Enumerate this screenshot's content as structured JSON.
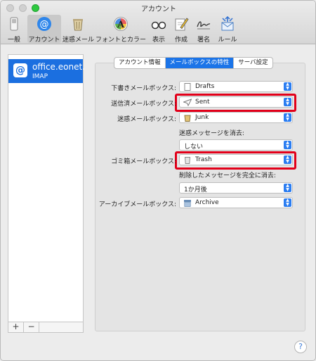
{
  "window": {
    "title": "アカウント"
  },
  "toolbar": {
    "items": [
      {
        "label": "一般",
        "icon": "switch-icon"
      },
      {
        "label": "アカウント",
        "icon": "at-sign-icon",
        "selected": true
      },
      {
        "label": "迷惑メール",
        "icon": "trash-bin-icon"
      },
      {
        "label": "フォントとカラー",
        "icon": "font-color-icon"
      },
      {
        "label": "表示",
        "icon": "glasses-icon"
      },
      {
        "label": "作成",
        "icon": "pencil-paper-icon"
      },
      {
        "label": "署名",
        "icon": "signature-icon"
      },
      {
        "label": "ルール",
        "icon": "rules-envelope-icon"
      }
    ]
  },
  "sidebar": {
    "account": {
      "name": "office.eonet.",
      "type": "IMAP",
      "icon": "at-sign-icon"
    },
    "add_label": "+",
    "remove_label": "−"
  },
  "tabs": [
    {
      "label": "アカウント情報",
      "active": false
    },
    {
      "label": "メールボックスの特性",
      "active": true
    },
    {
      "label": "サーバ設定",
      "active": false
    }
  ],
  "mailbox": {
    "drafts": {
      "label": "下書きメールボックス:",
      "value": "Drafts",
      "icon": "document-icon"
    },
    "sent": {
      "label": "送信済メールボックス:",
      "value": "Sent",
      "icon": "sent-plane-icon",
      "highlighted": true
    },
    "junk": {
      "label": "迷惑メールボックス:",
      "value": "Junk",
      "icon": "junk-bin-icon"
    },
    "junk_erase": {
      "label": "迷惑メッセージを消去:",
      "value": "しない"
    },
    "trash": {
      "label": "ゴミ箱メールボックス:",
      "value": "Trash",
      "icon": "trash-can-icon",
      "highlighted": true
    },
    "trash_erase": {
      "label": "削除したメッセージを完全に消去:",
      "value": "1か月後"
    },
    "archive": {
      "label": "アーカイブメールボックス:",
      "value": "Archive",
      "icon": "archive-box-icon"
    }
  },
  "colors": {
    "accent": "#1b74e8",
    "highlight": "#e2001a",
    "zoom": "#2dc93f"
  },
  "help": {
    "label": "?"
  }
}
